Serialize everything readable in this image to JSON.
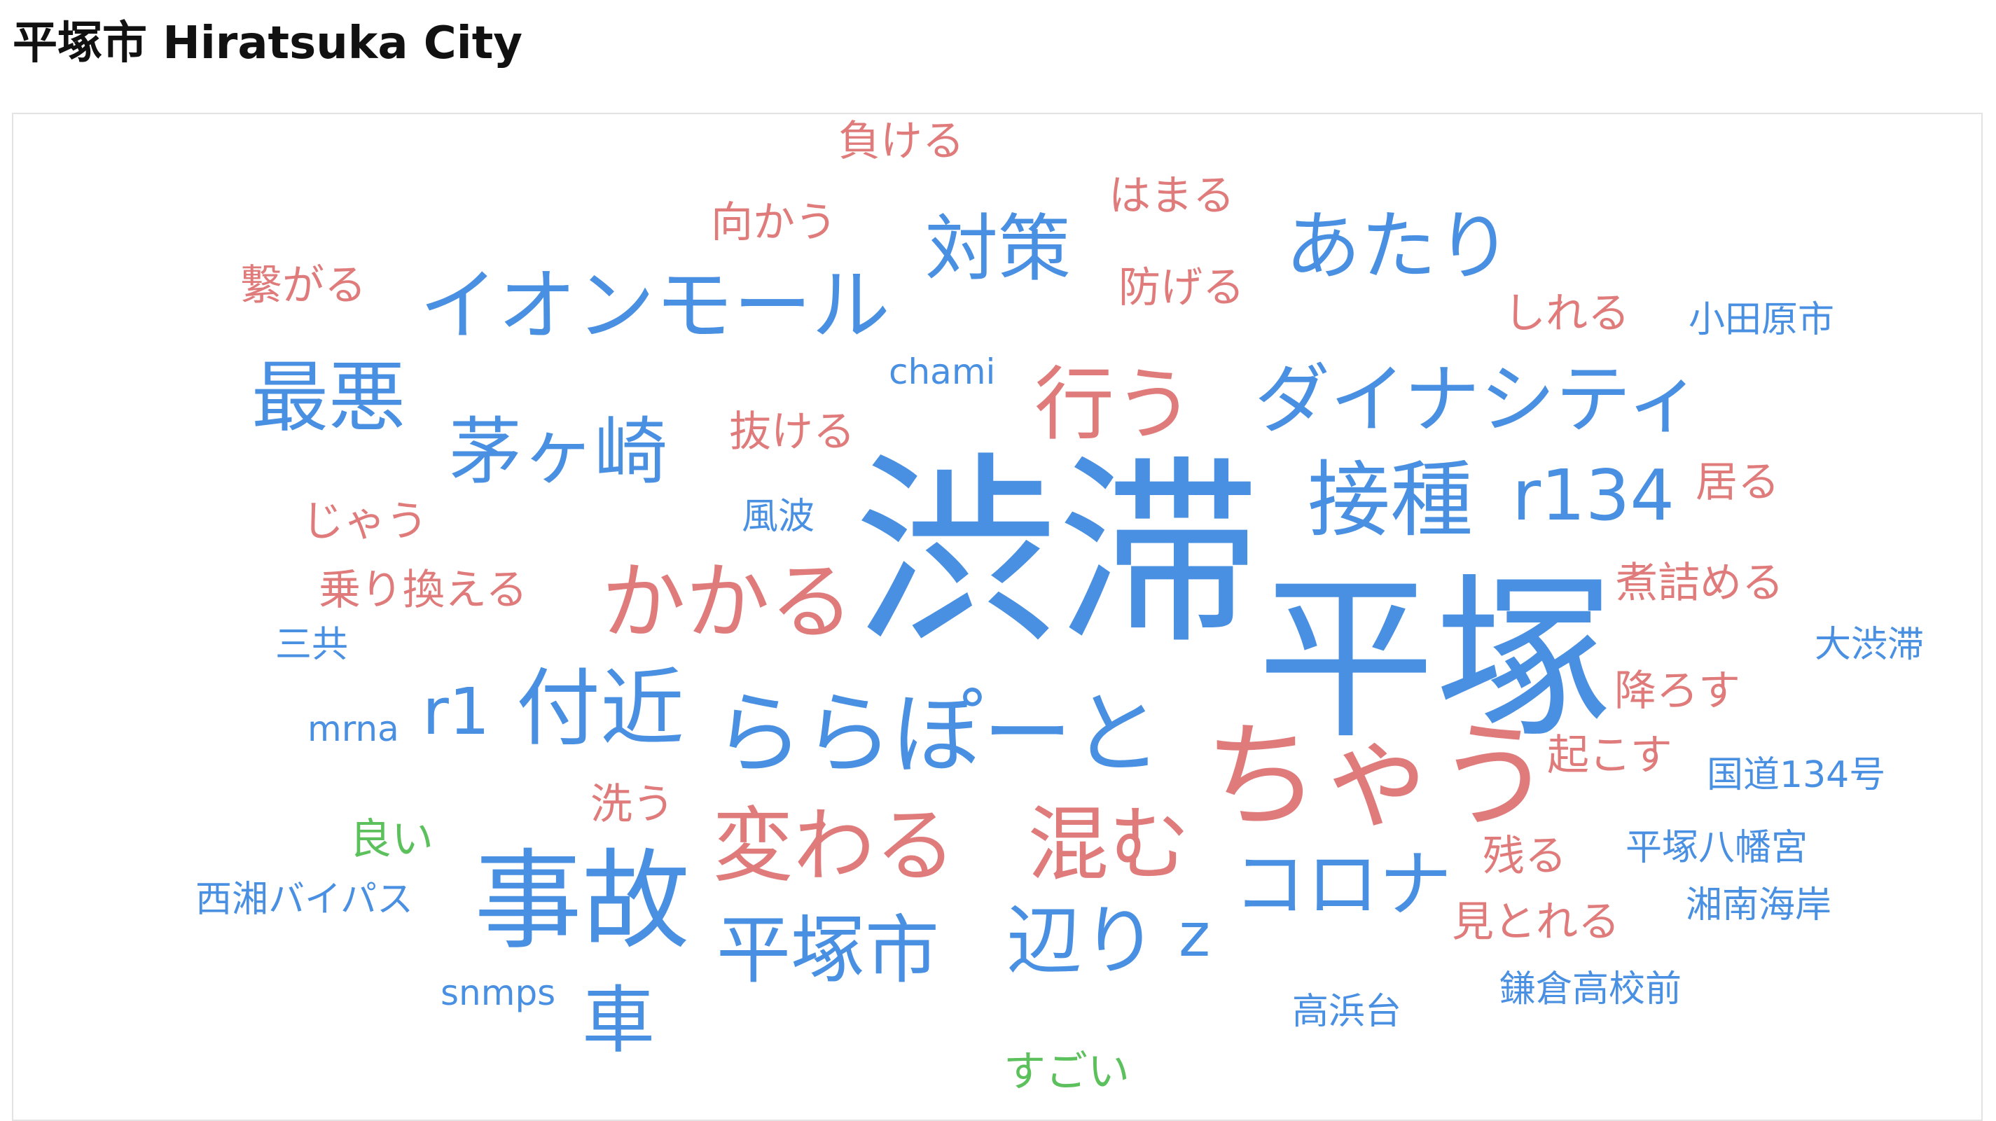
{
  "page": {
    "title": "平塚市 Hiratsuka City"
  },
  "colors": {
    "noun": "#4a90e2",
    "verb": "#e07b7b",
    "adjective": "#5cc15c"
  },
  "word_cloud": {
    "words": [
      {
        "text": "渋滞",
        "category": "noun"
      },
      {
        "text": "平塚",
        "category": "noun"
      },
      {
        "text": "ちゃう",
        "category": "verb"
      },
      {
        "text": "ららぽーと",
        "category": "noun"
      },
      {
        "text": "事故",
        "category": "noun"
      },
      {
        "text": "イオンモール",
        "category": "noun"
      },
      {
        "text": "ダイナシティ",
        "category": "noun"
      },
      {
        "text": "かかる",
        "category": "verb"
      },
      {
        "text": "変わる",
        "category": "verb"
      },
      {
        "text": "混む",
        "category": "verb"
      },
      {
        "text": "行う",
        "category": "verb"
      },
      {
        "text": "接種",
        "category": "noun"
      },
      {
        "text": "あたり",
        "category": "noun"
      },
      {
        "text": "付近",
        "category": "noun"
      },
      {
        "text": "茅ヶ崎",
        "category": "noun"
      },
      {
        "text": "最悪",
        "category": "noun"
      },
      {
        "text": "対策",
        "category": "noun"
      },
      {
        "text": "r134",
        "category": "noun"
      },
      {
        "text": "コロナ",
        "category": "noun"
      },
      {
        "text": "平塚市",
        "category": "noun"
      },
      {
        "text": "辺り",
        "category": "noun"
      },
      {
        "text": "車",
        "category": "noun"
      },
      {
        "text": "r1",
        "category": "noun"
      },
      {
        "text": "z",
        "category": "noun"
      },
      {
        "text": "負ける",
        "category": "verb"
      },
      {
        "text": "はまる",
        "category": "verb"
      },
      {
        "text": "向かう",
        "category": "verb"
      },
      {
        "text": "繋がる",
        "category": "verb"
      },
      {
        "text": "防げる",
        "category": "verb"
      },
      {
        "text": "しれる",
        "category": "verb"
      },
      {
        "text": "小田原市",
        "category": "noun"
      },
      {
        "text": "chami",
        "category": "noun"
      },
      {
        "text": "抜ける",
        "category": "verb"
      },
      {
        "text": "居る",
        "category": "verb"
      },
      {
        "text": "じゃう",
        "category": "verb"
      },
      {
        "text": "風波",
        "category": "noun"
      },
      {
        "text": "煮詰める",
        "category": "verb"
      },
      {
        "text": "乗り換える",
        "category": "verb"
      },
      {
        "text": "三共",
        "category": "noun"
      },
      {
        "text": "大渋滞",
        "category": "noun"
      },
      {
        "text": "降ろす",
        "category": "verb"
      },
      {
        "text": "mrna",
        "category": "noun"
      },
      {
        "text": "起こす",
        "category": "verb"
      },
      {
        "text": "国道134号",
        "category": "noun"
      },
      {
        "text": "洗う",
        "category": "verb"
      },
      {
        "text": "良い",
        "category": "adjective"
      },
      {
        "text": "平塚八幡宮",
        "category": "noun"
      },
      {
        "text": "残る",
        "category": "verb"
      },
      {
        "text": "西湘バイパス",
        "category": "noun"
      },
      {
        "text": "湘南海岸",
        "category": "noun"
      },
      {
        "text": "見とれる",
        "category": "verb"
      },
      {
        "text": "snmps",
        "category": "noun"
      },
      {
        "text": "鎌倉高校前",
        "category": "noun"
      },
      {
        "text": "高浜台",
        "category": "noun"
      },
      {
        "text": "すごい",
        "category": "adjective"
      }
    ]
  }
}
